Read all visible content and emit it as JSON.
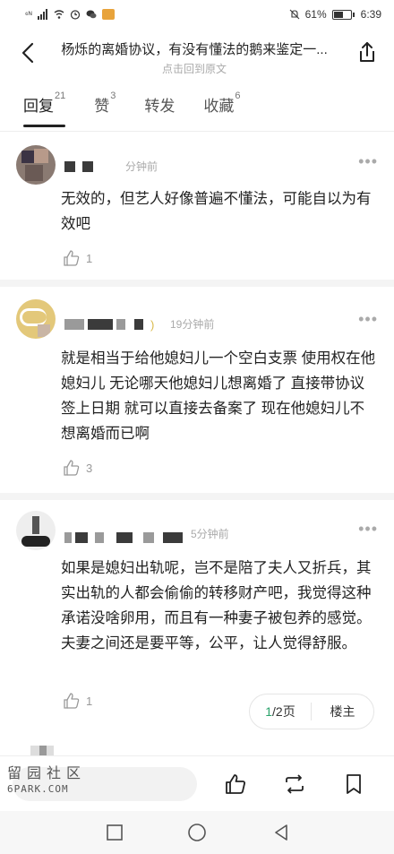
{
  "status": {
    "left": "⁶ᴺ",
    "battery_text": "61%",
    "battery_level": 0.61,
    "time": "6:39"
  },
  "header": {
    "title": "杨烁的离婚协议，有没有懂法的鹅来鉴定一...",
    "subtitle": "点击回到原文"
  },
  "tabs": [
    {
      "label": "回复",
      "count": "21"
    },
    {
      "label": "赞",
      "count": "3"
    },
    {
      "label": "转发",
      "count": ""
    },
    {
      "label": "收藏",
      "count": "6"
    }
  ],
  "comments": [
    {
      "time": "分钟前",
      "text": "无效的，但艺人好像普遍不懂法，可能自以为有效吧",
      "likes": "1"
    },
    {
      "time": "19分钟前",
      "text": "就是相当于给他媳妇儿一个空白支票 使用权在他媳妇儿 无论哪天他媳妇儿想离婚了 直接带协议 签上日期 就可以直接去备案了 现在他媳妇儿不想离婚而已啊",
      "likes": "3"
    },
    {
      "time": "5分钟前",
      "text": "如果是媳妇出轨呢，岂不是陪了夫人又折兵，其实出轨的人都会偷偷的转移财产吧，我觉得这种承诺没啥卵用，而且有一种妻子被包养的感觉。夫妻之间还是要平等，公平，让人觉得舒服。",
      "likes": "1"
    }
  ],
  "pager": {
    "current": "1",
    "total_label": "/2页",
    "op_label": "楼主"
  },
  "watermark": {
    "line1": "留园社区",
    "line2": "6PARK.COM"
  },
  "icons": {
    "back": "back-arrow-icon",
    "share": "share-icon",
    "like": "thumbs-up-icon",
    "repost": "repost-icon",
    "bookmark": "bookmark-icon",
    "more": "more-dots-icon"
  },
  "colors": {
    "accent_green": "#2aa36b",
    "text": "#222222",
    "muted": "#aaaaaa"
  }
}
